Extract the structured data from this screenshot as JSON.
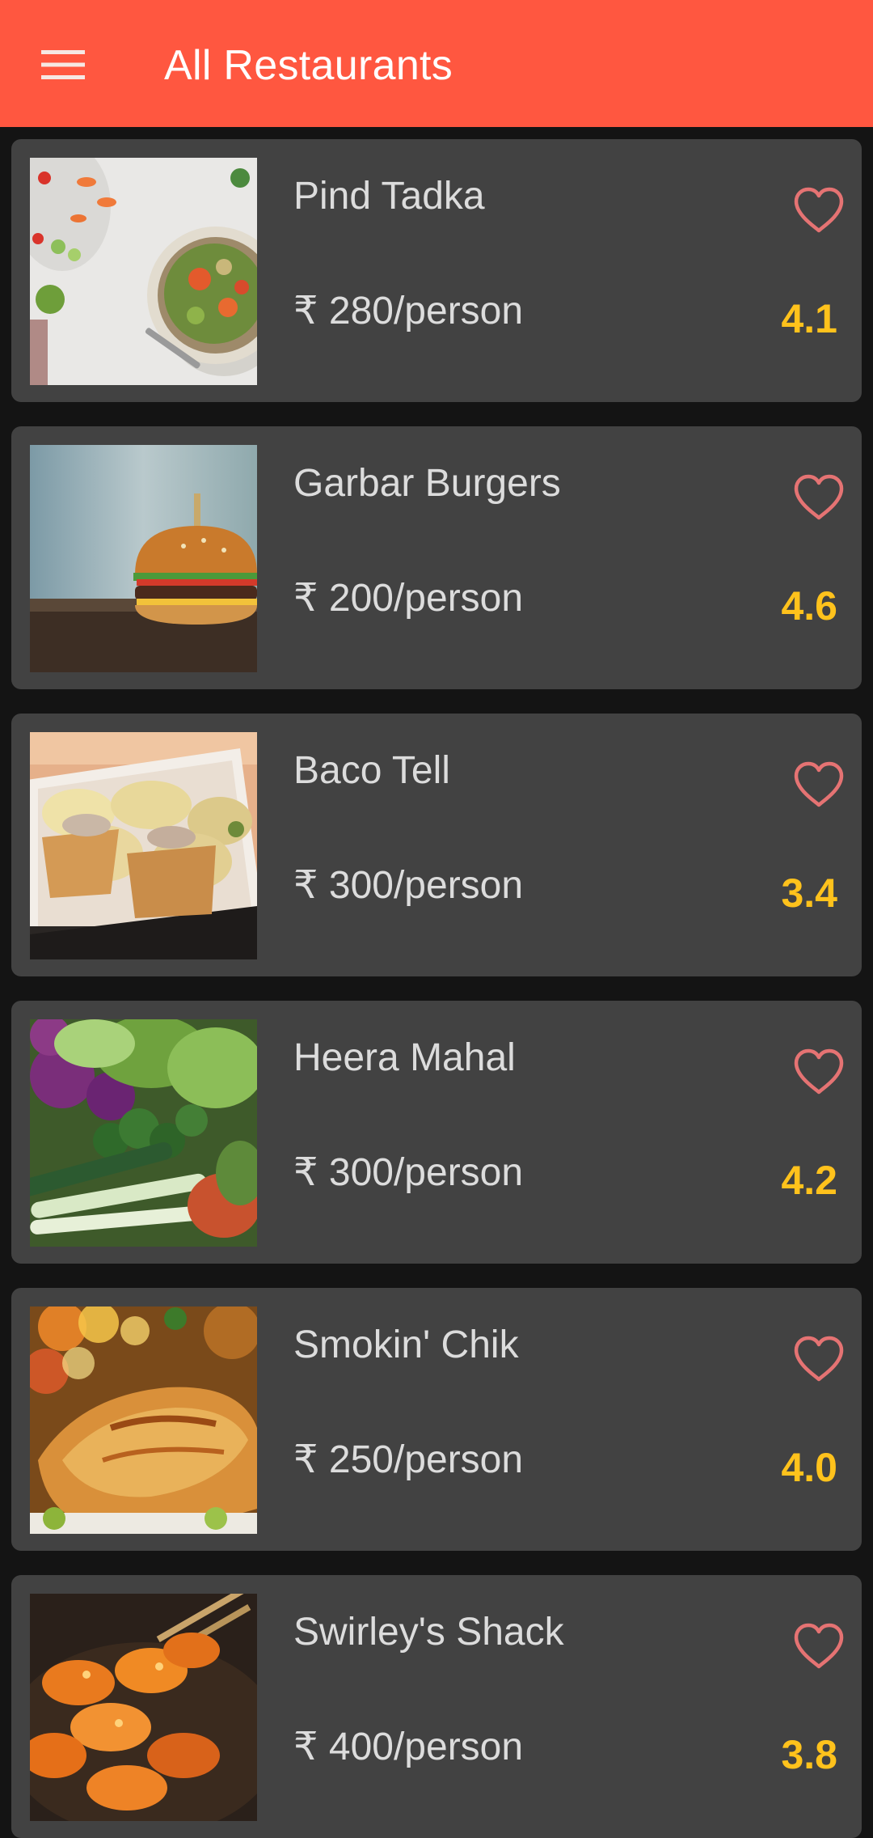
{
  "app": {
    "title": "All Restaurants",
    "colors": {
      "toolbar": "#FF5740",
      "card": "#424242",
      "background": "#141414",
      "rating": "#FFC21C",
      "favorite_outline": "#E57373"
    }
  },
  "restaurants": [
    {
      "name": "Pind Tadka",
      "price": "₹ 280/person",
      "rating": "4.1",
      "image": "salad-bowl-photo",
      "favorite_icon": "heart-outline-icon"
    },
    {
      "name": "Garbar Burgers",
      "price": "₹ 200/person",
      "rating": "4.6",
      "image": "burger-photo",
      "favorite_icon": "heart-outline-icon"
    },
    {
      "name": "Baco Tell",
      "price": "₹ 300/person",
      "rating": "3.4",
      "image": "tacos-photo",
      "favorite_icon": "heart-outline-icon"
    },
    {
      "name": "Heera Mahal",
      "price": "₹ 300/person",
      "rating": "4.2",
      "image": "vegetables-photo",
      "favorite_icon": "heart-outline-icon"
    },
    {
      "name": "Smokin' Chik",
      "price": "₹ 250/person",
      "rating": "4.0",
      "image": "roast-chicken-photo",
      "favorite_icon": "heart-outline-icon"
    },
    {
      "name": "Swirley's Shack",
      "price": "₹ 400/person",
      "rating": "3.8",
      "image": "shrimp-skewers-photo",
      "favorite_icon": "heart-outline-icon"
    }
  ]
}
